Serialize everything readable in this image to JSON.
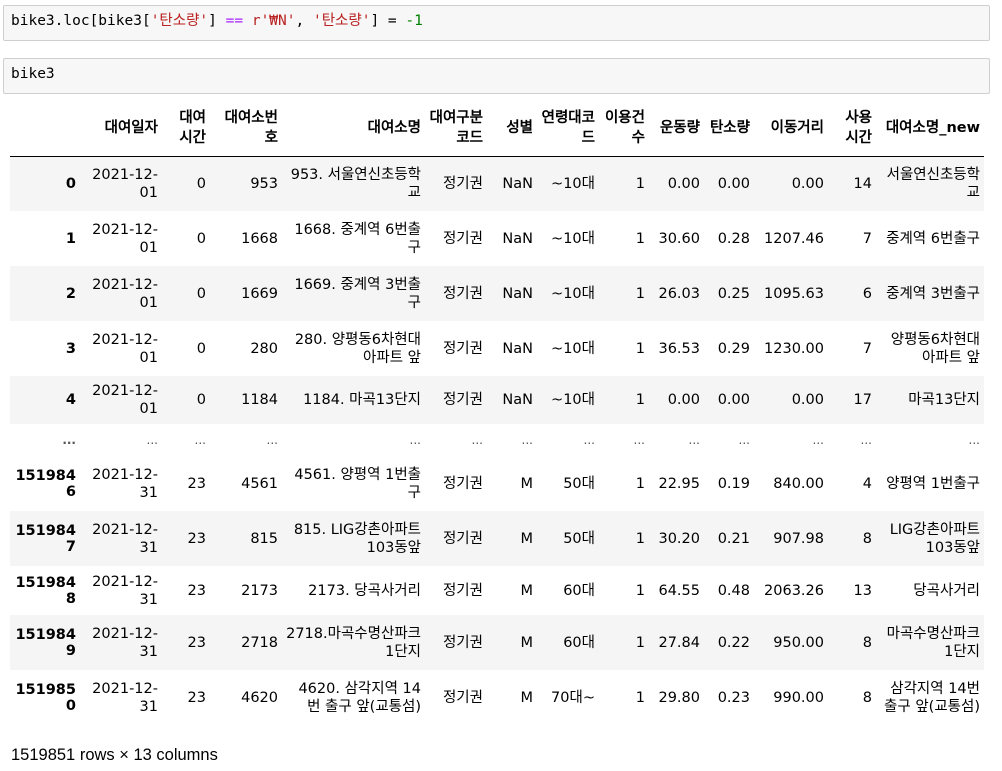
{
  "cells": {
    "code1": {
      "prefix": "bike3.loc[bike3[",
      "str1": "'탄소량'",
      "mid1": "] ",
      "op": "==",
      "mid2": " ",
      "str2": "r'₩N'",
      "mid3": ", ",
      "str3": "'탄소량'",
      "mid4": "] = ",
      "num": "-1"
    },
    "code2": "bike3"
  },
  "table": {
    "columns": [
      "",
      "대여일자",
      "대여시간",
      "대여소번호",
      "대여소명",
      "대여구분코드",
      "성별",
      "연령대코드",
      "이용건수",
      "운동량",
      "탄소량",
      "이동거리",
      "사용시간",
      "대여소명_new"
    ],
    "rows": [
      [
        "0",
        "2021-12-01",
        "0",
        "953",
        "953. 서울연신초등학교",
        "정기권",
        "NaN",
        "~10대",
        "1",
        "0.00",
        "0.00",
        "0.00",
        "14",
        "서울연신초등학교"
      ],
      [
        "1",
        "2021-12-01",
        "0",
        "1668",
        "1668. 중계역 6번출구",
        "정기권",
        "NaN",
        "~10대",
        "1",
        "30.60",
        "0.28",
        "1207.46",
        "7",
        "중계역 6번출구"
      ],
      [
        "2",
        "2021-12-01",
        "0",
        "1669",
        "1669. 중계역 3번출구",
        "정기권",
        "NaN",
        "~10대",
        "1",
        "26.03",
        "0.25",
        "1095.63",
        "6",
        "중계역 3번출구"
      ],
      [
        "3",
        "2021-12-01",
        "0",
        "280",
        "280. 양평동6차현대아파트 앞",
        "정기권",
        "NaN",
        "~10대",
        "1",
        "36.53",
        "0.29",
        "1230.00",
        "7",
        "양평동6차현대아파트 앞"
      ],
      [
        "4",
        "2021-12-01",
        "0",
        "1184",
        "1184. 마곡13단지",
        "정기권",
        "NaN",
        "~10대",
        "1",
        "0.00",
        "0.00",
        "0.00",
        "17",
        "마곡13단지"
      ],
      [
        "...",
        "...",
        "...",
        "...",
        "...",
        "...",
        "...",
        "...",
        "...",
        "...",
        "...",
        "...",
        "...",
        "..."
      ],
      [
        "1519846",
        "2021-12-31",
        "23",
        "4561",
        "4561. 양평역 1번출구",
        "정기권",
        "M",
        "50대",
        "1",
        "22.95",
        "0.19",
        "840.00",
        "4",
        "양평역 1번출구"
      ],
      [
        "1519847",
        "2021-12-31",
        "23",
        "815",
        "815. LIG강촌아파트 103동앞",
        "정기권",
        "M",
        "50대",
        "1",
        "30.20",
        "0.21",
        "907.98",
        "8",
        "LIG강촌아파트 103동앞"
      ],
      [
        "1519848",
        "2021-12-31",
        "23",
        "2173",
        "2173. 당곡사거리",
        "정기권",
        "M",
        "60대",
        "1",
        "64.55",
        "0.48",
        "2063.26",
        "13",
        "당곡사거리"
      ],
      [
        "1519849",
        "2021-12-31",
        "23",
        "2718",
        "2718.마곡수명산파크1단지",
        "정기권",
        "M",
        "60대",
        "1",
        "27.84",
        "0.22",
        "950.00",
        "8",
        "마곡수명산파크1단지"
      ],
      [
        "1519850",
        "2021-12-31",
        "23",
        "4620",
        "4620. 삼각지역 14번 출구 앞(교통섬)",
        "정기권",
        "M",
        "70대~",
        "1",
        "29.80",
        "0.23",
        "990.00",
        "8",
        "삼각지역 14번 출구 앞(교통섬)"
      ]
    ]
  },
  "footer": "1519851 rows × 13 columns"
}
